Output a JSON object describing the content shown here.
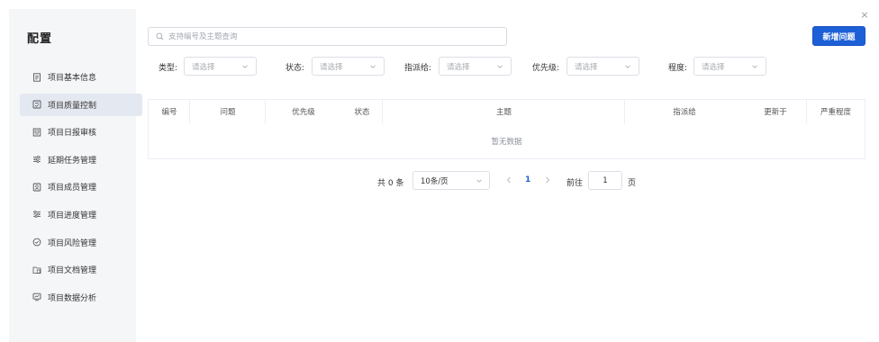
{
  "sidebar": {
    "title": "配置",
    "items": [
      {
        "label": "项目基本信息",
        "icon": "document-info-icon"
      },
      {
        "label": "项目质量控制",
        "icon": "quality-check-icon",
        "active": true
      },
      {
        "label": "项目日报审核",
        "icon": "daily-report-icon"
      },
      {
        "label": "延期任务管理",
        "icon": "delay-task-icon"
      },
      {
        "label": "项目成员管理",
        "icon": "member-icon"
      },
      {
        "label": "项目进度管理",
        "icon": "progress-icon"
      },
      {
        "label": "项目风险管理",
        "icon": "risk-icon"
      },
      {
        "label": "项目文档管理",
        "icon": "folder-doc-icon"
      },
      {
        "label": "项目数据分析",
        "icon": "analytics-icon"
      }
    ]
  },
  "search": {
    "placeholder": "支持编号及主题查询"
  },
  "toolbar": {
    "add_label": "新增问题"
  },
  "filters": [
    {
      "label": "类型:",
      "placeholder": "请选择"
    },
    {
      "label": "状态:",
      "placeholder": "请选择"
    },
    {
      "label": "指派给:",
      "placeholder": "请选择"
    },
    {
      "label": "优先级:",
      "placeholder": "请选择"
    },
    {
      "label": "程度:",
      "placeholder": "请选择"
    }
  ],
  "table": {
    "columns": [
      "编号",
      "问题",
      "优先级",
      "状态",
      "主题",
      "指派给",
      "更新于",
      "严重程度"
    ],
    "empty_text": "暂无数据"
  },
  "pagination": {
    "total_text": "共 0 条",
    "page_size": "10条/页",
    "current_page": "1",
    "goto_label": "前往",
    "goto_value": "1",
    "page_suffix": "页"
  },
  "colors": {
    "accent": "#1d5fd6",
    "sidebar_bg": "#f5f6f8",
    "active_bg": "#e4e8f1"
  }
}
